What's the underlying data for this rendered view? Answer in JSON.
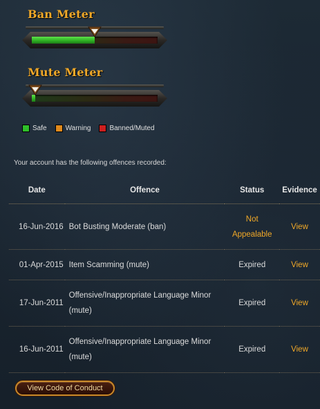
{
  "ban_meter": {
    "title": "Ban Meter",
    "level": 0.5
  },
  "mute_meter": {
    "title": "Mute Meter",
    "level": 0.03
  },
  "legend": [
    {
      "label": "Safe",
      "color": "#2fbf2a"
    },
    {
      "label": "Warning",
      "color": "#e08a1c"
    },
    {
      "label": "Banned/Muted",
      "color": "#cc1f1f"
    }
  ],
  "intro_text": "Your account has the following offences recorded:",
  "table": {
    "headers": {
      "date": "Date",
      "offence": "Offence",
      "status": "Status",
      "evidence": "Evidence"
    },
    "rows": [
      {
        "date": "16-Jun-2016",
        "offence": "Bot Busting Moderate (ban)",
        "status": "Not Appealable",
        "evidence": "View"
      },
      {
        "date": "01-Apr-2015",
        "offence": "Item Scamming (mute)",
        "status": "Expired",
        "evidence": "View"
      },
      {
        "date": "17-Jun-2011",
        "offence": "Offensive/Inappropriate Language Minor (mute)",
        "status": "Expired",
        "evidence": "View"
      },
      {
        "date": "16-Jun-2011",
        "offence": "Offensive/Inappropriate Language Minor (mute)",
        "status": "Expired",
        "evidence": "View"
      }
    ]
  },
  "code_of_conduct_button": "View Code of Conduct",
  "colors": {
    "accent": "#f0a828",
    "meter_fill": "#2fb324"
  }
}
